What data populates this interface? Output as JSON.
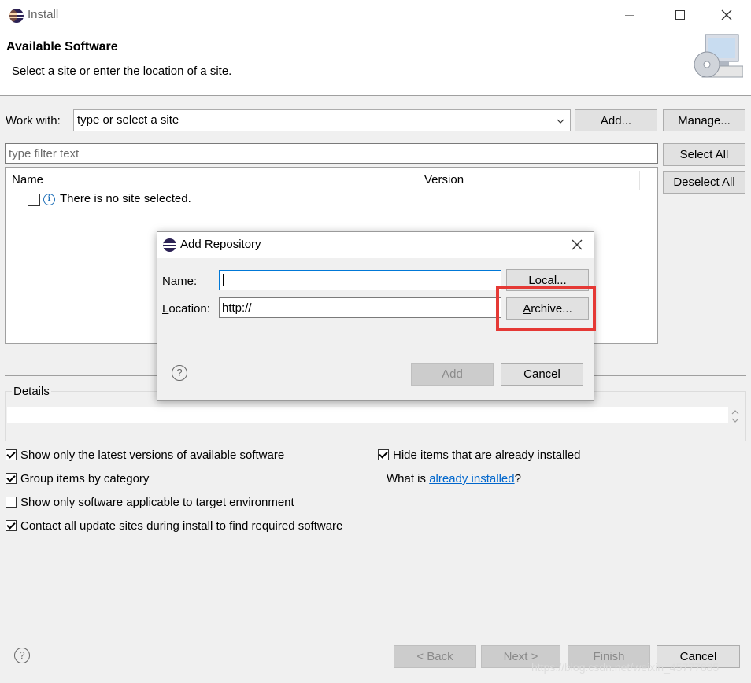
{
  "window": {
    "title": "Install"
  },
  "header": {
    "title": "Available Software",
    "subtitle": "Select a site or enter the location of a site."
  },
  "work_with": {
    "label": "Work with:",
    "placeholder": "type or select a site",
    "add_label": "Add...",
    "manage_label": "Manage..."
  },
  "filter": {
    "placeholder": "type filter text"
  },
  "side_buttons": {
    "select_all": "Select All",
    "deselect_all": "Deselect All"
  },
  "table": {
    "columns": [
      "Name",
      "Version"
    ],
    "rows": [
      {
        "label": "There is no site selected."
      }
    ]
  },
  "details": {
    "label": "Details"
  },
  "options": {
    "latest_versions": "Show only the latest versions of available software",
    "group_by_category": "Group items by category",
    "target_env": "Show only software applicable to target environment",
    "contact_sites": "Contact all update sites during install to find required software",
    "hide_installed": "Hide items that are already installed",
    "what_is": "What is",
    "already_installed_link": "already installed",
    "qmark": "?"
  },
  "footer": {
    "back": "< Back",
    "next": "Next >",
    "finish": "Finish",
    "cancel": "Cancel"
  },
  "watermark": "https://blog.csdn.net/weixin_45777885",
  "dialog": {
    "title": "Add Repository",
    "name_label_u": "N",
    "name_label_rest": "ame:",
    "location_label_u": "L",
    "location_label_rest": "ocation:",
    "name_value": "",
    "location_value": "http://",
    "local_label": "Local...",
    "archive_label_u": "A",
    "archive_label_rest": "rchive...",
    "add_label": "Add",
    "cancel_label": "Cancel"
  },
  "colors": {
    "highlight": "#e53935",
    "link": "#0066cc",
    "focus": "#0078d7"
  }
}
